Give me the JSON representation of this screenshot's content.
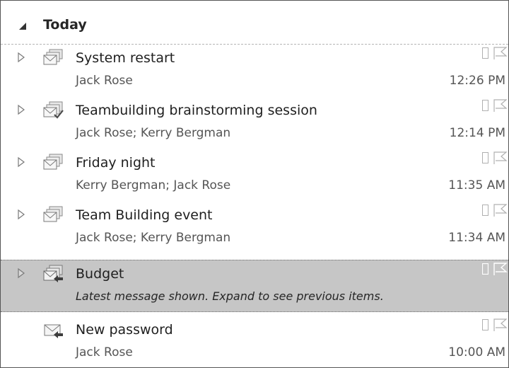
{
  "group": {
    "title": "Today"
  },
  "conversations": [
    {
      "subject": "System restart",
      "sender": "Jack Rose",
      "time": "12:26 PM",
      "icon": "envelope-stack-icon",
      "expandable": true
    },
    {
      "subject": "Teambuilding brainstorming session",
      "sender": "Jack Rose;  Kerry Bergman",
      "time": "12:14 PM",
      "icon": "envelope-stack-check-icon",
      "expandable": true
    },
    {
      "subject": "Friday night",
      "sender": "Kerry Bergman;  Jack Rose",
      "time": "11:35 AM",
      "icon": "envelope-stack-icon",
      "expandable": true
    },
    {
      "subject": "Team Building event",
      "sender": "Jack Rose;  Kerry Bergman",
      "time": "11:34 AM",
      "icon": "envelope-stack-icon",
      "expandable": true
    },
    {
      "subject": "Budget",
      "sender": "Latest message shown. Expand to see previous items.",
      "time": "",
      "icon": "envelope-stack-reply-icon",
      "expandable": true,
      "selected": true
    },
    {
      "subject": "New password",
      "sender": "Jack Rose",
      "time": "10:00 AM",
      "icon": "envelope-reply-icon",
      "expandable": false
    }
  ],
  "colors": {
    "selected_row": "#c6c6c6",
    "text": "#262626",
    "secondary_text": "#555555",
    "border": "#555555"
  }
}
